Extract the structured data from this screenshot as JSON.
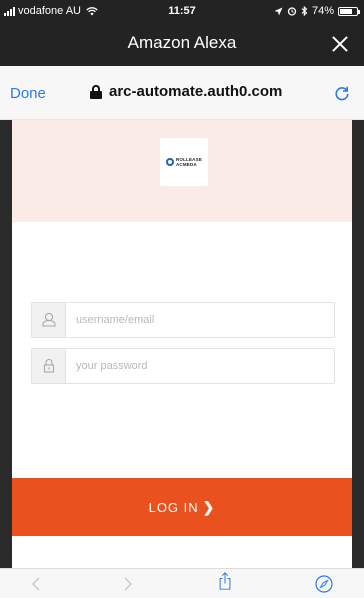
{
  "status_bar": {
    "carrier": "vodafone AU",
    "time": "11:57",
    "battery_percent": "74%",
    "battery_level": 0.74
  },
  "title_bar": {
    "title": "Amazon Alexa"
  },
  "browser_bar": {
    "done_label": "Done",
    "url": "arc-automate.auth0.com"
  },
  "logo": {
    "line1": "ROLLEASE",
    "line2": "ACMEDA"
  },
  "form": {
    "username_placeholder": "username/email",
    "password_placeholder": "your password",
    "login_label": "LOG IN",
    "login_chevron": "❯"
  },
  "colors": {
    "accent": "#e9511e",
    "header_band": "#fbebe6",
    "link_blue": "#2a7ae2"
  },
  "icons": {
    "close": "close-icon",
    "lock": "lock-icon",
    "reload": "reload-icon",
    "user": "user-icon",
    "padlock": "padlock-icon",
    "back": "back-icon",
    "forward": "forward-icon",
    "share": "share-icon",
    "safari": "safari-compass-icon"
  }
}
